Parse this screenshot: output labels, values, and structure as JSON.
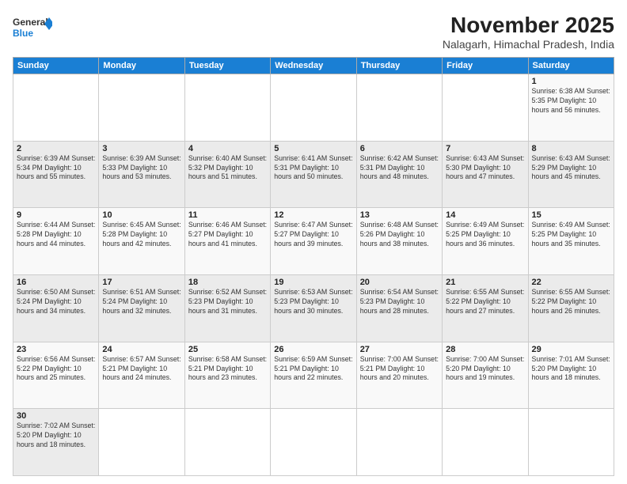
{
  "logo": {
    "text_general": "General",
    "text_blue": "Blue"
  },
  "header": {
    "month_year": "November 2025",
    "location": "Nalagarh, Himachal Pradesh, India"
  },
  "weekdays": [
    "Sunday",
    "Monday",
    "Tuesday",
    "Wednesday",
    "Thursday",
    "Friday",
    "Saturday"
  ],
  "weeks": [
    [
      {
        "day": "",
        "info": ""
      },
      {
        "day": "",
        "info": ""
      },
      {
        "day": "",
        "info": ""
      },
      {
        "day": "",
        "info": ""
      },
      {
        "day": "",
        "info": ""
      },
      {
        "day": "",
        "info": ""
      },
      {
        "day": "1",
        "info": "Sunrise: 6:38 AM\nSunset: 5:35 PM\nDaylight: 10 hours\nand 56 minutes."
      }
    ],
    [
      {
        "day": "2",
        "info": "Sunrise: 6:39 AM\nSunset: 5:34 PM\nDaylight: 10 hours\nand 55 minutes."
      },
      {
        "day": "3",
        "info": "Sunrise: 6:39 AM\nSunset: 5:33 PM\nDaylight: 10 hours\nand 53 minutes."
      },
      {
        "day": "4",
        "info": "Sunrise: 6:40 AM\nSunset: 5:32 PM\nDaylight: 10 hours\nand 51 minutes."
      },
      {
        "day": "5",
        "info": "Sunrise: 6:41 AM\nSunset: 5:31 PM\nDaylight: 10 hours\nand 50 minutes."
      },
      {
        "day": "6",
        "info": "Sunrise: 6:42 AM\nSunset: 5:31 PM\nDaylight: 10 hours\nand 48 minutes."
      },
      {
        "day": "7",
        "info": "Sunrise: 6:43 AM\nSunset: 5:30 PM\nDaylight: 10 hours\nand 47 minutes."
      },
      {
        "day": "8",
        "info": "Sunrise: 6:43 AM\nSunset: 5:29 PM\nDaylight: 10 hours\nand 45 minutes."
      }
    ],
    [
      {
        "day": "9",
        "info": "Sunrise: 6:44 AM\nSunset: 5:28 PM\nDaylight: 10 hours\nand 44 minutes."
      },
      {
        "day": "10",
        "info": "Sunrise: 6:45 AM\nSunset: 5:28 PM\nDaylight: 10 hours\nand 42 minutes."
      },
      {
        "day": "11",
        "info": "Sunrise: 6:46 AM\nSunset: 5:27 PM\nDaylight: 10 hours\nand 41 minutes."
      },
      {
        "day": "12",
        "info": "Sunrise: 6:47 AM\nSunset: 5:27 PM\nDaylight: 10 hours\nand 39 minutes."
      },
      {
        "day": "13",
        "info": "Sunrise: 6:48 AM\nSunset: 5:26 PM\nDaylight: 10 hours\nand 38 minutes."
      },
      {
        "day": "14",
        "info": "Sunrise: 6:49 AM\nSunset: 5:25 PM\nDaylight: 10 hours\nand 36 minutes."
      },
      {
        "day": "15",
        "info": "Sunrise: 6:49 AM\nSunset: 5:25 PM\nDaylight: 10 hours\nand 35 minutes."
      }
    ],
    [
      {
        "day": "16",
        "info": "Sunrise: 6:50 AM\nSunset: 5:24 PM\nDaylight: 10 hours\nand 34 minutes."
      },
      {
        "day": "17",
        "info": "Sunrise: 6:51 AM\nSunset: 5:24 PM\nDaylight: 10 hours\nand 32 minutes."
      },
      {
        "day": "18",
        "info": "Sunrise: 6:52 AM\nSunset: 5:23 PM\nDaylight: 10 hours\nand 31 minutes."
      },
      {
        "day": "19",
        "info": "Sunrise: 6:53 AM\nSunset: 5:23 PM\nDaylight: 10 hours\nand 30 minutes."
      },
      {
        "day": "20",
        "info": "Sunrise: 6:54 AM\nSunset: 5:23 PM\nDaylight: 10 hours\nand 28 minutes."
      },
      {
        "day": "21",
        "info": "Sunrise: 6:55 AM\nSunset: 5:22 PM\nDaylight: 10 hours\nand 27 minutes."
      },
      {
        "day": "22",
        "info": "Sunrise: 6:55 AM\nSunset: 5:22 PM\nDaylight: 10 hours\nand 26 minutes."
      }
    ],
    [
      {
        "day": "23",
        "info": "Sunrise: 6:56 AM\nSunset: 5:22 PM\nDaylight: 10 hours\nand 25 minutes."
      },
      {
        "day": "24",
        "info": "Sunrise: 6:57 AM\nSunset: 5:21 PM\nDaylight: 10 hours\nand 24 minutes."
      },
      {
        "day": "25",
        "info": "Sunrise: 6:58 AM\nSunset: 5:21 PM\nDaylight: 10 hours\nand 23 minutes."
      },
      {
        "day": "26",
        "info": "Sunrise: 6:59 AM\nSunset: 5:21 PM\nDaylight: 10 hours\nand 22 minutes."
      },
      {
        "day": "27",
        "info": "Sunrise: 7:00 AM\nSunset: 5:21 PM\nDaylight: 10 hours\nand 20 minutes."
      },
      {
        "day": "28",
        "info": "Sunrise: 7:00 AM\nSunset: 5:20 PM\nDaylight: 10 hours\nand 19 minutes."
      },
      {
        "day": "29",
        "info": "Sunrise: 7:01 AM\nSunset: 5:20 PM\nDaylight: 10 hours\nand 18 minutes."
      }
    ],
    [
      {
        "day": "30",
        "info": "Sunrise: 7:02 AM\nSunset: 5:20 PM\nDaylight: 10 hours\nand 18 minutes."
      },
      {
        "day": "",
        "info": ""
      },
      {
        "day": "",
        "info": ""
      },
      {
        "day": "",
        "info": ""
      },
      {
        "day": "",
        "info": ""
      },
      {
        "day": "",
        "info": ""
      },
      {
        "day": "",
        "info": ""
      }
    ]
  ]
}
